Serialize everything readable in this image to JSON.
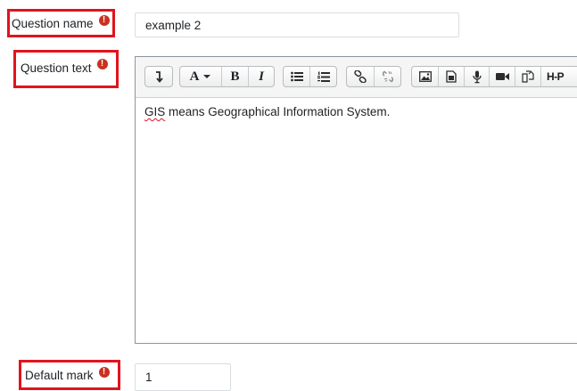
{
  "question_name": {
    "label": "Question name",
    "required_icon": "exclamation-circle-icon",
    "value": "example 2"
  },
  "question_text": {
    "label": "Question text",
    "required_icon": "exclamation-circle-icon",
    "toolbar": {
      "groups": [
        [
          "show-more-icon"
        ],
        [
          "font-style-icon",
          "bold-icon",
          "italic-icon"
        ],
        [
          "unordered-list-icon",
          "ordered-list-icon"
        ],
        [
          "link-icon",
          "unlink-icon"
        ],
        [
          "image-icon",
          "media-icon",
          "record-audio-icon",
          "record-video-icon",
          "manage-files-icon",
          "h5p-icon"
        ]
      ],
      "bold_glyph": "B",
      "italic_glyph": "I",
      "h5p_text": "H-P"
    },
    "content": {
      "misspelled_word": "GIS",
      "rest": " means Geographical Information System."
    }
  },
  "default_mark": {
    "label": "Default mark",
    "required_icon": "exclamation-circle-icon",
    "value": "1"
  },
  "colors": {
    "highlight_border": "#e0141e",
    "required_icon": "#ca3120"
  }
}
